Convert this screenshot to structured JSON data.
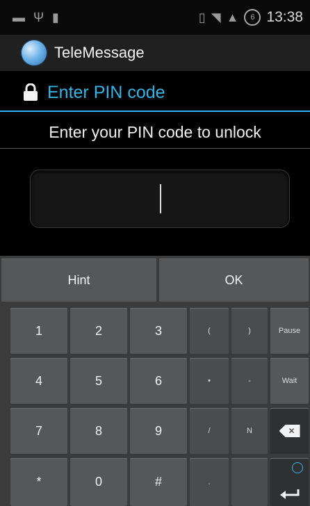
{
  "status_bar": {
    "time": "13:38",
    "icons": [
      "dash-icon",
      "usb-icon",
      "sd-card-icon",
      "vibrate-icon",
      "wifi-icon",
      "signal-icon",
      "notification-icon"
    ],
    "notification_badge": "6"
  },
  "app_bar": {
    "title": "TeleMessage",
    "logo": "telemessage-logo"
  },
  "dialog": {
    "title": "Enter PIN code",
    "prompt": "Enter your PIN code to unlock",
    "pin_value": ""
  },
  "keyboard": {
    "hint_label": "Hint",
    "ok_label": "OK",
    "rows": [
      [
        "1",
        "2",
        "3",
        "(",
        ")",
        "Pause"
      ],
      [
        "4",
        "5",
        "6",
        "•",
        "-",
        "Wait"
      ],
      [
        "7",
        "8",
        "9",
        "/",
        "N",
        ""
      ],
      [
        "*",
        "0",
        "#",
        ".",
        "",
        ""
      ]
    ]
  },
  "colors": {
    "accent": "#33b5e5",
    "background": "#000000",
    "key": "#555759"
  }
}
